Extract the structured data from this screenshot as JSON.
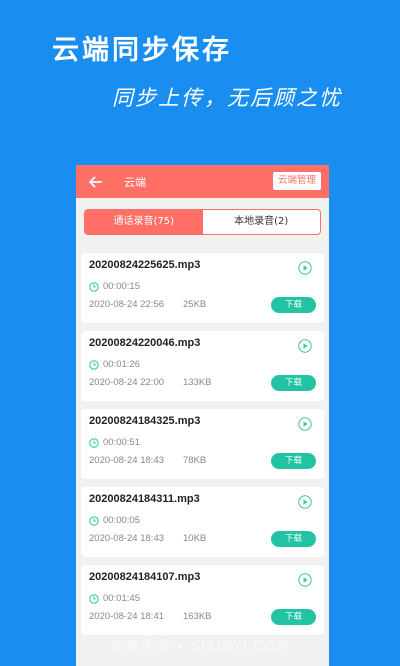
{
  "promo": {
    "headline": "云端同步保存",
    "subline": "同步上传，无后顾之忧"
  },
  "appbar": {
    "title": "云端",
    "manage_label": "云端管理",
    "back_icon": "arrow-left-icon"
  },
  "tabs": [
    {
      "label": "通话录音(75)",
      "active": true
    },
    {
      "label": "本地录音(2)",
      "active": false
    }
  ],
  "recordings": [
    {
      "file": "20200824225625.mp3",
      "duration": "00:00:15",
      "datetime": "2020-08-24 22:56",
      "size": "25KB",
      "download_label": "下载"
    },
    {
      "file": "20200824220046.mp3",
      "duration": "00:01:26",
      "datetime": "2020-08-24 22:00",
      "size": "133KB",
      "download_label": "下载"
    },
    {
      "file": "20200824184325.mp3",
      "duration": "00:00:51",
      "datetime": "2020-08-24 18:43",
      "size": "78KB",
      "download_label": "下载"
    },
    {
      "file": "20200824184311.mp3",
      "duration": "00:00:05",
      "datetime": "2020-08-24 18:43",
      "size": "10KB",
      "download_label": "下载"
    },
    {
      "file": "20200824184107.mp3",
      "duration": "00:01:45",
      "datetime": "2020-08-24 18:41",
      "size": "163KB",
      "download_label": "下载"
    }
  ],
  "watermark": "新意手游 • SJXINYI.COM",
  "colors": {
    "background": "#1a8ef0",
    "accent": "#ff6f66",
    "download": "#22c3a2",
    "icon": "#3cc7a8"
  }
}
